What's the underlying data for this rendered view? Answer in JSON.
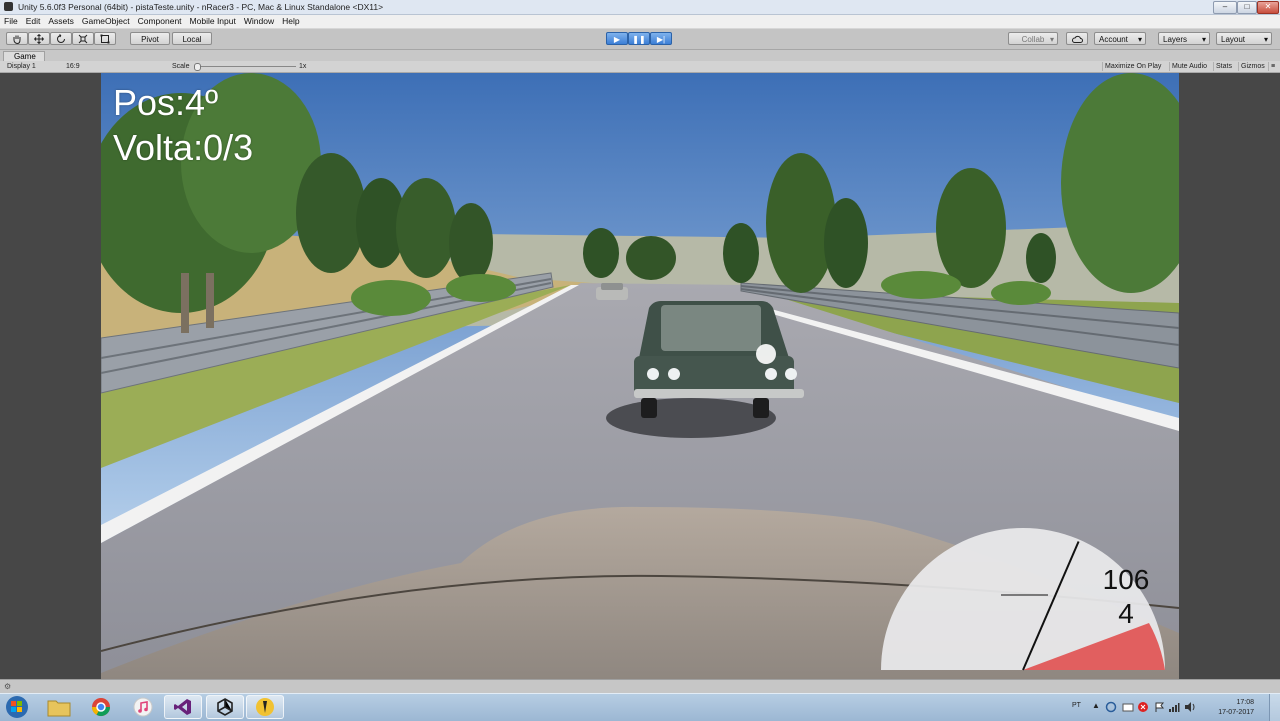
{
  "window": {
    "title": "Unity 5.6.0f3 Personal (64bit) - pistaTeste.unity - nRacer3 - PC, Mac & Linux Standalone <DX11>",
    "controls": {
      "minimize": "–",
      "maximize": "□",
      "close": "✕"
    }
  },
  "menu": [
    "File",
    "Edit",
    "Assets",
    "GameObject",
    "Component",
    "Mobile Input",
    "Window",
    "Help"
  ],
  "toolbar": {
    "tools": [
      "hand-icon",
      "move-icon",
      "rotate-icon",
      "scale-icon",
      "rect-icon"
    ],
    "pivot_label": "Pivot",
    "local_label": "Local",
    "play_icon": "▶",
    "pause_icon": "❚❚",
    "step_icon": "▶|",
    "collab_label": "Collab",
    "account_label": "Account",
    "layers_label": "Layers",
    "layout_label": "Layout"
  },
  "game_panel": {
    "tab_label": "Game",
    "display_label": "Display 1",
    "aspect_label": "16:9",
    "scale_label": "Scale",
    "scale_value": "1x",
    "maximize_label": "Maximize On Play",
    "mute_label": "Mute Audio",
    "stats_label": "Stats",
    "gizmos_label": "Gizmos"
  },
  "hud": {
    "position": "Pos:4º",
    "lap": "Volta:0/3",
    "speed": "106",
    "gear": "4",
    "speedometer_level": 0.63
  },
  "taskbar": {
    "apps": [
      "start-orb",
      "file-explorer-icon",
      "chrome-icon",
      "itunes-icon",
      "visual-studio-icon",
      "unity-icon",
      "app-icon"
    ],
    "language": "PT",
    "time": "17:08",
    "date": "17-07-2017"
  },
  "colors": {
    "redline": "#e04848",
    "sky_top": "#3d6fb6",
    "grass": "#9bad56"
  }
}
